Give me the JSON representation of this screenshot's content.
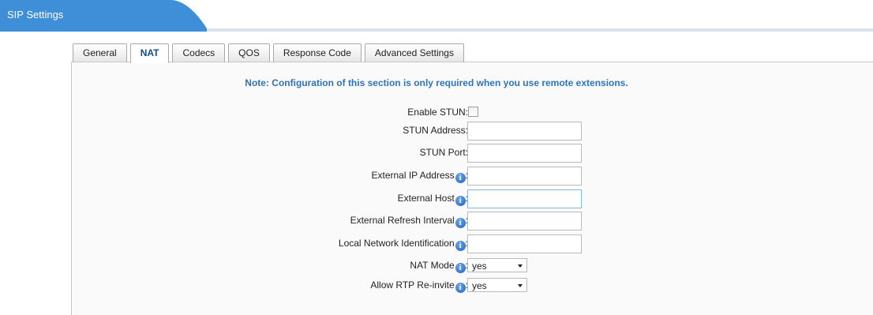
{
  "header": {
    "title": "SIP Settings"
  },
  "tabs": [
    {
      "label": "General",
      "active": false
    },
    {
      "label": "NAT",
      "active": true
    },
    {
      "label": "Codecs",
      "active": false
    },
    {
      "label": "QOS",
      "active": false
    },
    {
      "label": "Response Code",
      "active": false
    },
    {
      "label": "Advanced Settings",
      "active": false
    }
  ],
  "note": "Note: Configuration of this section is only required when you use remote extensions.",
  "fields": {
    "enable_stun": {
      "label": "Enable STUN:",
      "checked": false
    },
    "stun_address": {
      "label": "STUN Address:",
      "value": ""
    },
    "stun_port": {
      "label": "STUN Port:",
      "value": ""
    },
    "external_ip": {
      "label": "External IP Address",
      "value": ""
    },
    "external_host": {
      "label": "External Host",
      "value": ""
    },
    "external_refresh": {
      "label": "External Refresh Interval",
      "value": ""
    },
    "local_network": {
      "label": "Local Network Identification",
      "value": ""
    },
    "nat_mode": {
      "label": "NAT Mode",
      "value": "yes"
    },
    "allow_rtp": {
      "label": "Allow RTP Re-invite",
      "value": "yes"
    },
    "colon": ":"
  },
  "colors": {
    "header": "#3e8fd8",
    "note": "#2e73b9"
  },
  "icons": {
    "info": "info-icon"
  }
}
